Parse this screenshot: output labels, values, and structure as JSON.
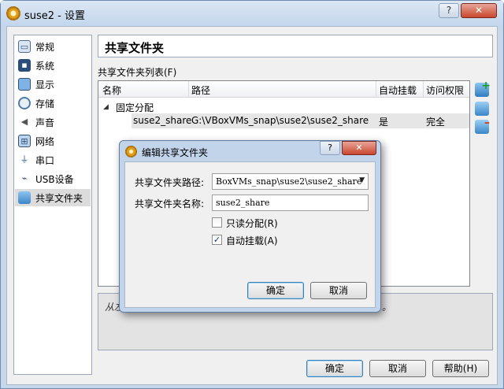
{
  "window": {
    "title": "suse2 - 设置",
    "help_btn": "?",
    "close_btn": "✕"
  },
  "sidebar": {
    "items": [
      {
        "label": "常规",
        "icon": "general-icon"
      },
      {
        "label": "系统",
        "icon": "system-icon"
      },
      {
        "label": "显示",
        "icon": "display-icon"
      },
      {
        "label": "存储",
        "icon": "storage-icon"
      },
      {
        "label": "声音",
        "icon": "audio-icon"
      },
      {
        "label": "网络",
        "icon": "network-icon"
      },
      {
        "label": "串口",
        "icon": "serial-port-icon"
      },
      {
        "label": "USB设备",
        "icon": "usb-icon"
      },
      {
        "label": "共享文件夹",
        "icon": "shared-folder-icon"
      }
    ],
    "selected": 8
  },
  "main": {
    "heading": "共享文件夹",
    "list_label": "共享文件夹列表(F)",
    "columns": [
      "名称",
      "路径",
      "自动挂载",
      "访问权限"
    ],
    "group": "固定分配",
    "rows": [
      {
        "name": "suse2_share",
        "path": "G:\\VBoxVMs_snap\\suse2\\suse2_share",
        "automount": "是",
        "access": "完全"
      }
    ],
    "info_text": "从左",
    "info_text_tail": "。"
  },
  "footer": {
    "ok": "确定",
    "cancel": "取消",
    "help": "帮助(H)"
  },
  "dialog": {
    "title": "编辑共享文件夹",
    "help_btn": "?",
    "close_btn": "✕",
    "path_label": "共享文件夹路径:",
    "path_value": "BoxVMs_snap\\suse2\\suse2_share",
    "name_label": "共享文件夹名称:",
    "name_value": "suse2_share",
    "readonly_label": "只读分配(R)",
    "readonly_checked": false,
    "automount_label": "自动挂载(A)",
    "automount_checked": true,
    "ok": "确定",
    "cancel": "取消"
  }
}
